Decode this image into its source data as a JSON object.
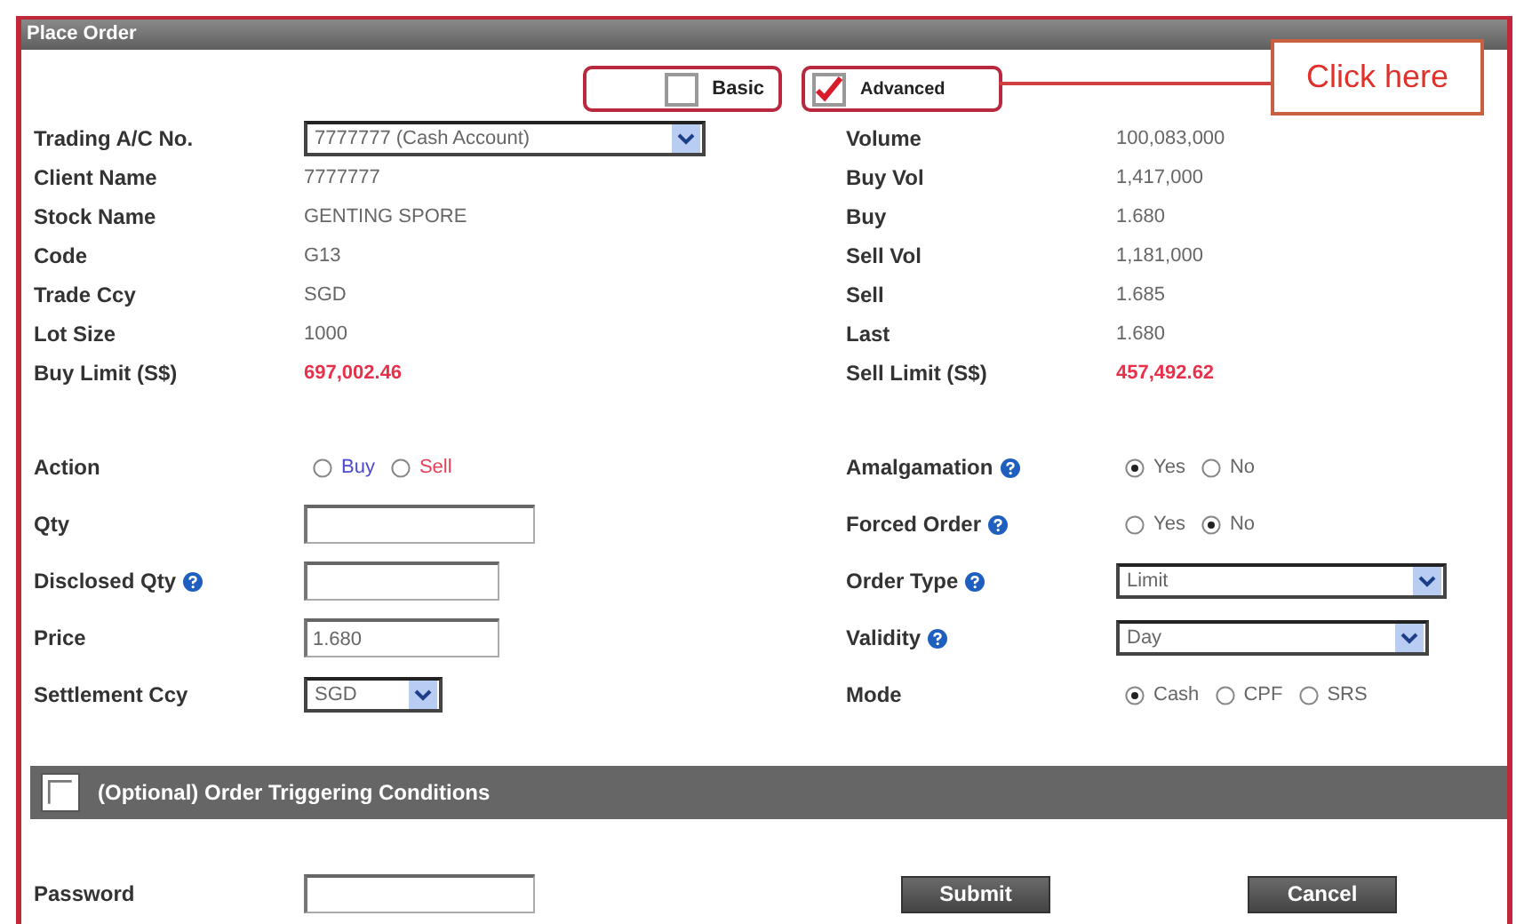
{
  "panel": {
    "title": "Place Order"
  },
  "view_toggles": [
    {
      "label": "Basic",
      "checked": false
    },
    {
      "label": "Advanced",
      "checked": true
    }
  ],
  "callout": {
    "text": "Click here"
  },
  "account_info": [
    {
      "label": "Trading A/C No.",
      "kind": "select",
      "value": "7777777 (Cash Account)"
    },
    {
      "label": "Client Name",
      "kind": "text",
      "value": "7777777"
    },
    {
      "label": "Stock Name",
      "kind": "text",
      "value": "GENTING SPORE"
    },
    {
      "label": "Code",
      "kind": "text",
      "value": "G13"
    },
    {
      "label": "Trade Ccy",
      "kind": "text",
      "value": "SGD"
    },
    {
      "label": "Lot Size",
      "kind": "text",
      "value": "1000"
    },
    {
      "label": "Buy Limit (S$)",
      "kind": "limit",
      "value": "697,002.46"
    }
  ],
  "market_info": [
    {
      "label": "Volume",
      "kind": "text",
      "value": "100,083,000"
    },
    {
      "label": "Buy Vol",
      "kind": "text",
      "value": "1,417,000"
    },
    {
      "label": "Buy",
      "kind": "text",
      "value": "1.680"
    },
    {
      "label": "Sell Vol",
      "kind": "text",
      "value": "1,181,000"
    },
    {
      "label": "Sell",
      "kind": "text",
      "value": "1.685"
    },
    {
      "label": "Last",
      "kind": "text",
      "value": "1.680"
    },
    {
      "label": "Sell Limit (S$)",
      "kind": "limit",
      "value": "457,492.62"
    }
  ],
  "order_left": [
    {
      "label": "Action",
      "help": false,
      "kind": "radio",
      "options": [
        {
          "label": "Buy",
          "selected": false,
          "color": "#4a4ad0"
        },
        {
          "label": "Sell",
          "selected": false,
          "color": "#e8405a"
        }
      ]
    },
    {
      "label": "Qty",
      "help": false,
      "kind": "input"
    },
    {
      "label": "Disclosed Qty",
      "help": true,
      "kind": "input"
    },
    {
      "label": "Price",
      "help": false,
      "kind": "input",
      "value": "1.680"
    },
    {
      "label": "Settlement Ccy",
      "help": false,
      "kind": "select",
      "value": "SGD"
    }
  ],
  "order_right": [
    {
      "label": "Amalgamation",
      "help": true,
      "kind": "radio",
      "options": [
        {
          "label": "Yes",
          "selected": true
        },
        {
          "label": "No",
          "selected": false
        }
      ]
    },
    {
      "label": "Forced Order",
      "help": true,
      "kind": "radio",
      "options": [
        {
          "label": "Yes",
          "selected": false
        },
        {
          "label": "No",
          "selected": true
        }
      ]
    },
    {
      "label": "Order Type",
      "help": true,
      "kind": "select",
      "value": "Limit"
    },
    {
      "label": "Validity",
      "help": true,
      "kind": "select",
      "value": "Day"
    },
    {
      "label": "Mode",
      "help": false,
      "kind": "radio",
      "options": [
        {
          "label": "Cash",
          "selected": true
        },
        {
          "label": "CPF",
          "selected": false
        },
        {
          "label": "SRS",
          "selected": false
        }
      ]
    }
  ],
  "trigger_section": {
    "label": "(Optional) Order Triggering Conditions",
    "checked": false
  },
  "password": {
    "label": "Password"
  },
  "buttons": [
    {
      "label": "Submit"
    },
    {
      "label": "Cancel"
    }
  ]
}
